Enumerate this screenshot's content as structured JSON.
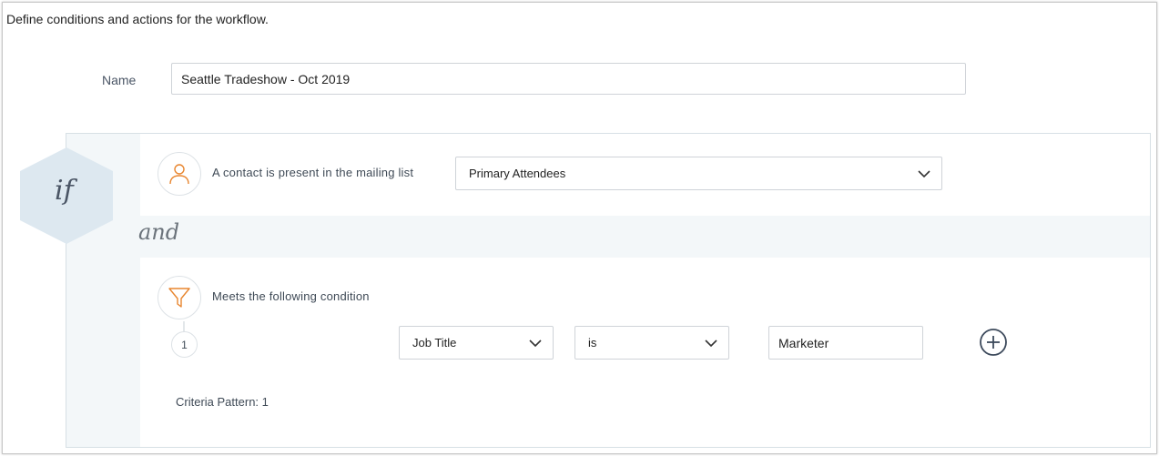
{
  "intro_text": "Define conditions and actions for the workflow.",
  "name_field": {
    "label": "Name",
    "value": "Seattle Tradeshow - Oct 2019"
  },
  "if_block": {
    "if_label": "if",
    "and_label": "and",
    "condition_1": {
      "icon": "user-icon",
      "text": "A contact is present in the mailing list",
      "selected_list": "Primary Attendees"
    },
    "condition_2": {
      "icon": "filter-icon",
      "text": "Meets the following condition",
      "rules": [
        {
          "index": "1",
          "field": "Job Title",
          "operator": "is",
          "value": "Marketer"
        }
      ],
      "criteria_pattern": "Criteria Pattern: 1"
    }
  },
  "colors": {
    "accent_orange": "#e8852e",
    "hex_fill": "#dde8f0",
    "panel_bg": "#f3f7f9",
    "add_icon": "#3d4a5c"
  }
}
